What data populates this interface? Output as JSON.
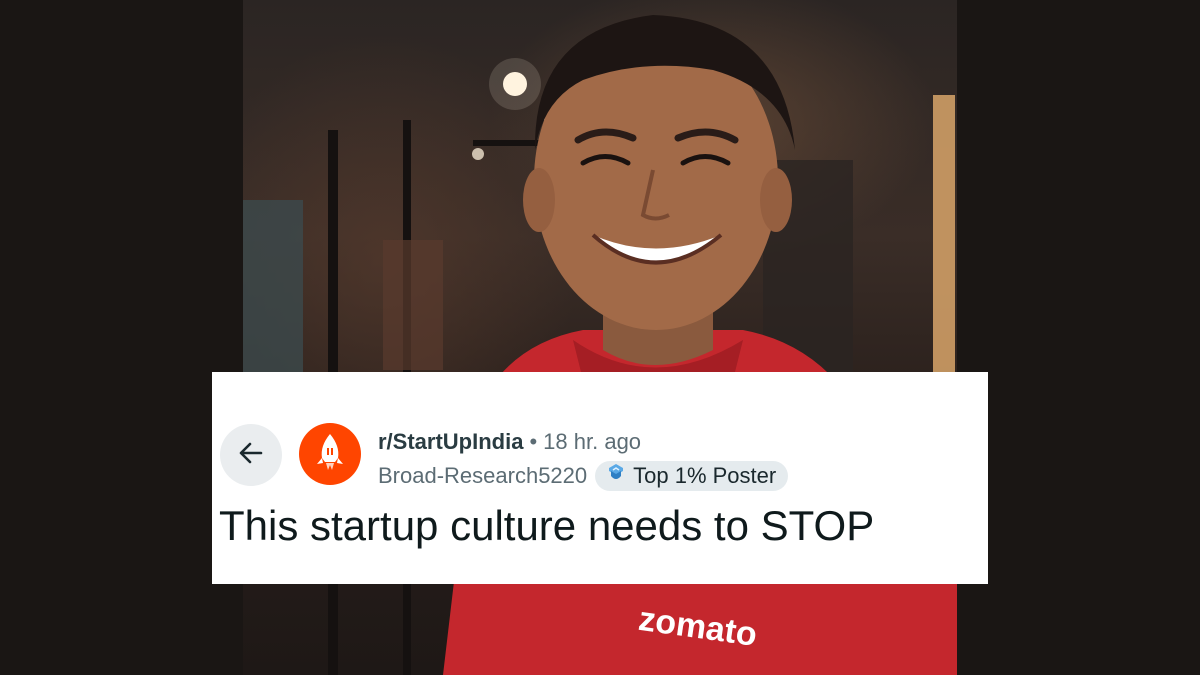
{
  "post": {
    "subreddit": "r/StartUpIndia",
    "separator": "•",
    "time_ago": "18 hr. ago",
    "author": "Broad-Research5220",
    "flair": "Top 1% Poster",
    "title": "This startup culture needs to STOP"
  },
  "photo": {
    "shirt_logo_text": "zomato",
    "shirt_color": "#c4272d"
  },
  "icons": {
    "back": "arrow-left-icon",
    "subreddit": "rocket-icon",
    "flair": "badge-icon"
  },
  "colors": {
    "brand_orange": "#ff4500",
    "page_background": "#1a1614",
    "card_background": "#ffffff"
  }
}
